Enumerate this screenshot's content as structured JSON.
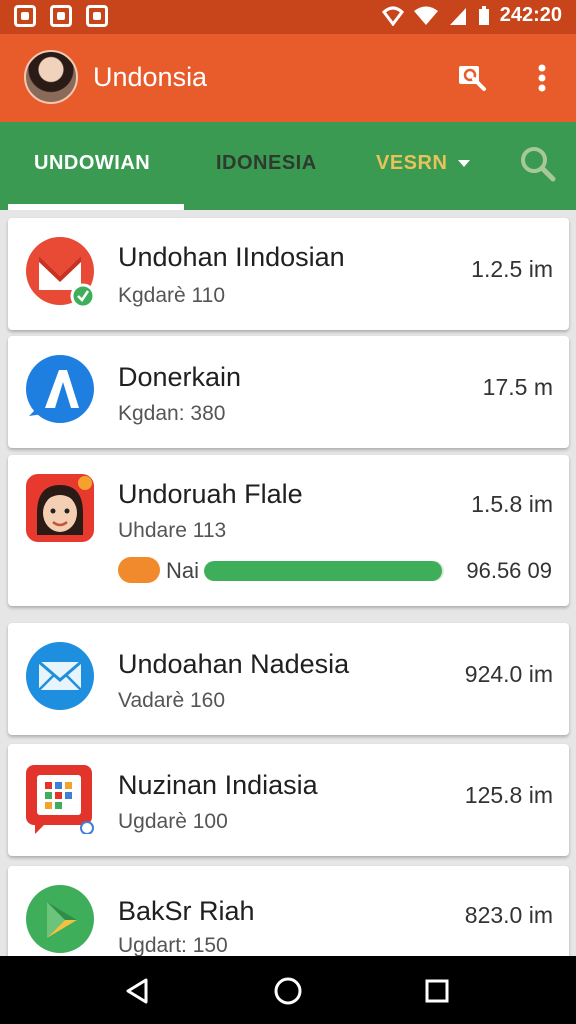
{
  "status_bar": {
    "time": "242:20"
  },
  "app_bar": {
    "title": "Undonsia"
  },
  "tabs": [
    {
      "label": "UNDOWIAN"
    },
    {
      "label": "IDONESIA"
    },
    {
      "label": "VESRN"
    }
  ],
  "colors": {
    "status_bar": "#c8441a",
    "app_bar": "#e85b2a",
    "tab_bar": "#3b9a52",
    "progress": "#3fae5a"
  },
  "apps": [
    {
      "name": "Undohan IIndosian",
      "sub": "Kgdarè 110",
      "size": "1.2.5 im",
      "icon": "red-m-icon"
    },
    {
      "name": "Donerkain",
      "sub": "Kgdan: 380",
      "size": "17.5 m",
      "icon": "blue-a-icon"
    },
    {
      "name": "Undoruah Flale",
      "sub": "Uhdare 113",
      "size": "1.5.8 im",
      "icon": "girl-face-icon",
      "progress": {
        "label": "Nai",
        "value": "96.56 09",
        "fraction": 0.99
      }
    },
    {
      "name": "Undoahan Nadesia",
      "sub": "Vadarè 160",
      "size": "924.0 im",
      "icon": "mail-icon"
    },
    {
      "name": "Nuzinan Indiasia",
      "sub": "Ugdarè 100",
      "size": "125.8 im",
      "icon": "grid-icon"
    },
    {
      "name": "BakSr Riah",
      "sub": "Ugdart: 150",
      "size": "823.0 im",
      "icon": "play-icon"
    }
  ]
}
